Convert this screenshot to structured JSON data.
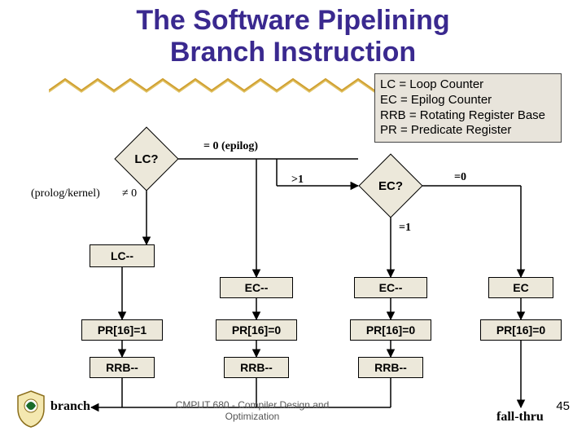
{
  "title_line1": "The Software Pipelining",
  "title_line2": "Branch Instruction",
  "legend": {
    "l1": "LC = Loop Counter",
    "l2": "EC = Epilog Counter",
    "l3": "RRB = Rotating Register Base",
    "l4": "PR = Predicate Register"
  },
  "diamond_lc": "LC?",
  "diamond_ec": "EC?",
  "edge_eq0_epilog": "= 0 (epilog)",
  "edge_gt1": ">1",
  "edge_eq0": "=0",
  "edge_eq1": "=1",
  "edge_ne0_prolog": "(prolog/kernel)",
  "edge_ne0_sym": "≠ 0",
  "node_lc_dec": "LC--",
  "node_ec_dec_1": "EC--",
  "node_ec_dec_2": "EC--",
  "node_ec": "EC",
  "node_pr1": "PR[16]=1",
  "node_pr0_a": "PR[16]=0",
  "node_pr0_b": "PR[16]=0",
  "node_pr0_c": "PR[16]=0",
  "node_rrb_a": "RRB--",
  "node_rrb_b": "RRB--",
  "node_rrb_c": "RRB--",
  "node_branch": "branch",
  "node_fall": "fall-thru",
  "footer": "CMPUT 680 - Compiler Design and Optimization",
  "pagenum": "45",
  "chart_data": {
    "type": "flowchart",
    "title": "The Software Pipelining Branch Instruction",
    "legend": {
      "LC": "Loop Counter",
      "EC": "Epilog Counter",
      "RRB": "Rotating Register Base",
      "PR": "Predicate Register"
    },
    "nodes": [
      {
        "id": "LC?",
        "kind": "decision"
      },
      {
        "id": "EC?",
        "kind": "decision"
      },
      {
        "id": "LC--",
        "kind": "process"
      },
      {
        "id": "EC--_1",
        "label": "EC--",
        "kind": "process"
      },
      {
        "id": "EC--_2",
        "label": "EC--",
        "kind": "process"
      },
      {
        "id": "EC",
        "kind": "process"
      },
      {
        "id": "PR[16]=1",
        "kind": "process"
      },
      {
        "id": "PR[16]=0_a",
        "label": "PR[16]=0",
        "kind": "process"
      },
      {
        "id": "PR[16]=0_b",
        "label": "PR[16]=0",
        "kind": "process"
      },
      {
        "id": "PR[16]=0_c",
        "label": "PR[16]=0",
        "kind": "process"
      },
      {
        "id": "RRB--_a",
        "label": "RRB--",
        "kind": "process"
      },
      {
        "id": "RRB--_b",
        "label": "RRB--",
        "kind": "process"
      },
      {
        "id": "RRB--_c",
        "label": "RRB--",
        "kind": "process"
      },
      {
        "id": "branch",
        "kind": "terminal"
      },
      {
        "id": "fall-thru",
        "kind": "terminal"
      }
    ],
    "edges": [
      {
        "from": "LC?",
        "to": "LC--",
        "label": "≠ 0 (prolog/kernel)"
      },
      {
        "from": "LC?",
        "to": "EC?",
        "label": "= 0 (epilog)"
      },
      {
        "from": "EC?",
        "to": "EC--_1",
        "label": ">1"
      },
      {
        "from": "EC?",
        "to": "EC--_2",
        "label": "=1"
      },
      {
        "from": "EC?",
        "to": "EC",
        "label": "=0"
      },
      {
        "from": "LC--",
        "to": "PR[16]=1"
      },
      {
        "from": "EC--_1",
        "to": "PR[16]=0_a"
      },
      {
        "from": "EC--_2",
        "to": "PR[16]=0_b"
      },
      {
        "from": "EC",
        "to": "PR[16]=0_c"
      },
      {
        "from": "PR[16]=1",
        "to": "RRB--_a"
      },
      {
        "from": "PR[16]=0_a",
        "to": "RRB--_b"
      },
      {
        "from": "PR[16]=0_b",
        "to": "RRB--_c"
      },
      {
        "from": "RRB--_a",
        "to": "branch"
      },
      {
        "from": "RRB--_b",
        "to": "branch"
      },
      {
        "from": "RRB--_c",
        "to": "branch"
      },
      {
        "from": "PR[16]=0_c",
        "to": "fall-thru"
      }
    ]
  }
}
